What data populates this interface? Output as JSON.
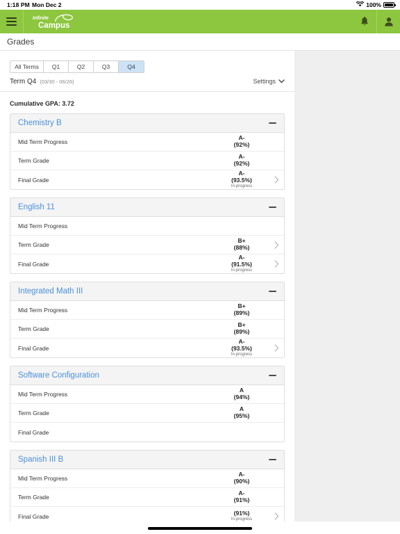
{
  "statusbar": {
    "time": "1:18 PM",
    "date": "Mon Dec 2",
    "battery_pct": "100%",
    "wifi_icon": "wifi-icon",
    "battery_icon": "battery-icon"
  },
  "appbar": {
    "menu_icon": "hamburger-menu-icon",
    "logo_line1": "Infinite",
    "logo_line2": "Campus",
    "notifications_icon": "bell-icon",
    "account_icon": "user-account-icon",
    "background_color": "#8dc63f"
  },
  "titlebar": {
    "title": "Grades"
  },
  "toolbar": {
    "term_tabs": [
      {
        "label": "All Terms",
        "active": false
      },
      {
        "label": "Q1",
        "active": false
      },
      {
        "label": "Q2",
        "active": false
      },
      {
        "label": "Q3",
        "active": false
      },
      {
        "label": "Q4",
        "active": true
      }
    ],
    "term_name": "Term Q4",
    "term_range": "(03/30 - 06/26)",
    "settings_label": "Settings",
    "settings_icon": "chevron-down-icon",
    "active_tab_color": "#cde3f5"
  },
  "summary": {
    "gpa_text": "Cumulative GPA: 3.72"
  },
  "courses": [
    {
      "name": "Chemistry B",
      "collapse_icon": "minus-icon",
      "rows": [
        {
          "label": "Mid Term Progress",
          "letter": "A-",
          "pct": "(92%)",
          "progress": "",
          "chevron": false
        },
        {
          "label": "Term Grade",
          "letter": "A-",
          "pct": "(92%)",
          "progress": "",
          "chevron": false
        },
        {
          "label": "Final Grade",
          "letter": "A-",
          "pct": "(93.5%)",
          "progress": "In-progress",
          "chevron": true
        }
      ]
    },
    {
      "name": "English 11",
      "collapse_icon": "minus-icon",
      "rows": [
        {
          "label": "Mid Term Progress",
          "letter": "",
          "pct": "",
          "progress": "",
          "chevron": false
        },
        {
          "label": "Term Grade",
          "letter": "B+",
          "pct": "(88%)",
          "progress": "",
          "chevron": true
        },
        {
          "label": "Final Grade",
          "letter": "A-",
          "pct": "(91.5%)",
          "progress": "In-progress",
          "chevron": true
        }
      ]
    },
    {
      "name": "Integrated Math III",
      "collapse_icon": "minus-icon",
      "rows": [
        {
          "label": "Mid Term Progress",
          "letter": "B+",
          "pct": "(89%)",
          "progress": "",
          "chevron": false
        },
        {
          "label": "Term Grade",
          "letter": "B+",
          "pct": "(89%)",
          "progress": "",
          "chevron": false
        },
        {
          "label": "Final Grade",
          "letter": "A-",
          "pct": "(93.5%)",
          "progress": "In-progress",
          "chevron": true
        }
      ]
    },
    {
      "name": "Software Configuration",
      "collapse_icon": "minus-icon",
      "rows": [
        {
          "label": "Mid Term Progress",
          "letter": "A",
          "pct": "(94%)",
          "progress": "",
          "chevron": false
        },
        {
          "label": "Term Grade",
          "letter": "A",
          "pct": "(95%)",
          "progress": "",
          "chevron": false
        },
        {
          "label": "Final Grade",
          "letter": "",
          "pct": "",
          "progress": "",
          "chevron": false
        }
      ]
    },
    {
      "name": "Spanish III B",
      "collapse_icon": "minus-icon",
      "rows": [
        {
          "label": "Mid Term Progress",
          "letter": "A-",
          "pct": "(90%)",
          "progress": "",
          "chevron": false
        },
        {
          "label": "Term Grade",
          "letter": "A-",
          "pct": "(91%)",
          "progress": "",
          "chevron": false
        },
        {
          "label": "Final Grade",
          "letter": "",
          "pct": "(91%)",
          "progress": "In-progress",
          "chevron": true
        }
      ]
    }
  ]
}
